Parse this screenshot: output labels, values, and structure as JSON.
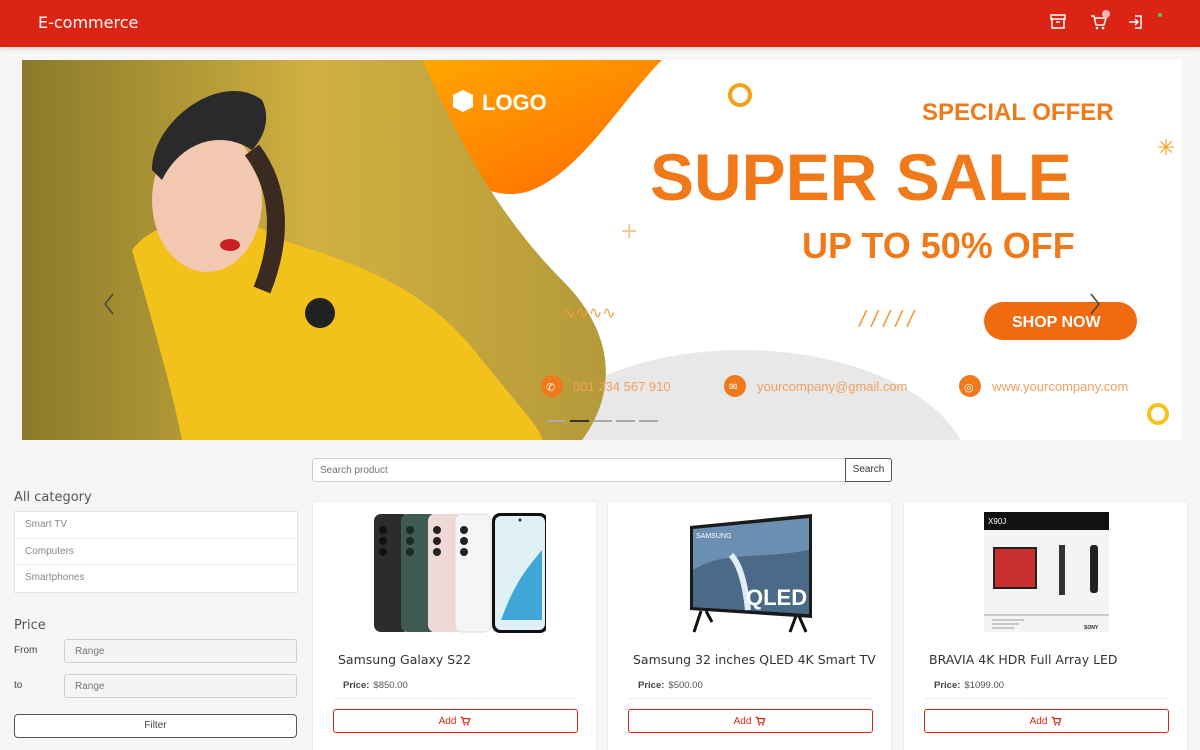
{
  "header": {
    "brand": "E-commerce",
    "icons": [
      "archive-icon",
      "cart-icon",
      "sign-in-icon"
    ],
    "brand_color": "#dc2414"
  },
  "carousel": {
    "slide": {
      "logo_text": "LOGO",
      "kicker": "SPECIAL OFFER",
      "headline": "SUPER SALE",
      "subline": "UP TO 50% OFF",
      "cta": "SHOP NOW",
      "phone": "001 234 567 910",
      "email": "yourcompany@gmail.com",
      "website": "www.yourcompany.com"
    },
    "indicator_count": 5,
    "active_index": 1
  },
  "sidebar": {
    "category_title": "All category",
    "categories": [
      "Smart TV",
      "Computers",
      "Smartphones"
    ],
    "price_title": "Price",
    "from_label": "From",
    "from_placeholder": "Range",
    "to_label": "to",
    "to_placeholder": "Range",
    "filter_label": "Filter"
  },
  "search": {
    "placeholder": "Search product",
    "button_label": "Search"
  },
  "products": [
    {
      "name": "Samsung Galaxy S22",
      "price_label": "Price:",
      "price": "$850.00",
      "add_label": "Add",
      "image": "smartphone-image"
    },
    {
      "name": "Samsung 32 inches QLED 4K Smart TV",
      "price_label": "Price:",
      "price": "$500.00",
      "add_label": "Add",
      "image": "tv-image",
      "image_text": "QLED",
      "image_brand": "SAMSUNG"
    },
    {
      "name": "BRAVIA 4K HDR Full Array LED",
      "price_label": "Price:",
      "price": "$1099.00",
      "add_label": "Add",
      "image": "tv-box-image",
      "image_text": "X90J",
      "image_brand": "SONY"
    }
  ]
}
